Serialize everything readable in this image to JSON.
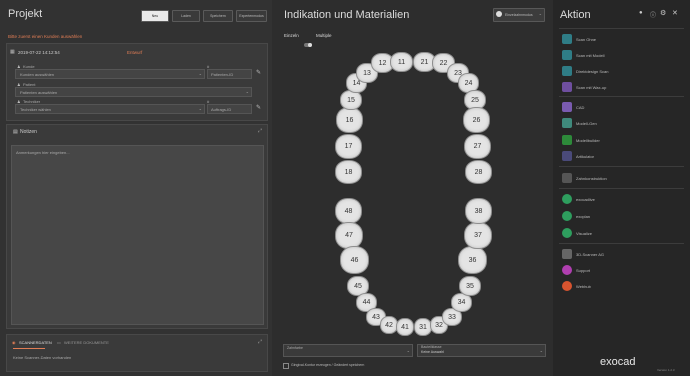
{
  "project": {
    "title": "Projekt",
    "toolbar": [
      "Neu",
      "Laden",
      "Speichern",
      "Expertenmodus"
    ],
    "warning": "Bitte zuerst einen Kunden auswählen",
    "date": "2019-07-22 14:12:54",
    "status_label": "Entwurf",
    "client": {
      "label": "Kunde",
      "value": "Kunden auswählen"
    },
    "patient": {
      "label": "Patient",
      "value": "Patienten auswählen"
    },
    "technician": {
      "label": "Techniker",
      "value": "Techniker wählen"
    },
    "id_placeholders": [
      "Patienten-ID",
      "Auftrags-ID"
    ],
    "notes_title": "Notizen",
    "notes_placeholder": "Anmerkungen hier eingeben...",
    "bottom_tabs": [
      "SCANNERDATEN",
      "WEITERE DOKUMENTE"
    ],
    "bottom_text": "Keine Scanner-Daten vorhanden"
  },
  "indikation": {
    "title": "Indikation und Materialien",
    "mode_label": "Einzelzahnmodus",
    "toggle_left": "Einzeln",
    "toggle_right": "Multiple",
    "teeth_upper": [
      "18",
      "17",
      "16",
      "15",
      "14",
      "13",
      "12",
      "11",
      "21",
      "22",
      "23",
      "24",
      "25",
      "26",
      "27",
      "28"
    ],
    "teeth_lower": [
      "48",
      "47",
      "46",
      "45",
      "44",
      "43",
      "42",
      "41",
      "31",
      "32",
      "33",
      "34",
      "35",
      "36",
      "37",
      "38"
    ],
    "select_left": "Zahnfarbe",
    "select_right_label": "Bauteilklasse",
    "select_right_value": "Keine Auswahl",
    "checkbox_label": "Gingival-Kontur erzeugen / Geändert speichern"
  },
  "aktion": {
    "title": "Aktion",
    "items_group1": [
      {
        "label": "Scan Ohne",
        "color": "#2f7d86"
      },
      {
        "label": "Scan mit Modell",
        "color": "#2f7d86"
      },
      {
        "label": "Direktdesign Scan",
        "color": "#2f7d86"
      },
      {
        "label": "Scan mit Wax-up",
        "color": "#6f4fa0"
      }
    ],
    "items_group2": [
      {
        "label": "CAD",
        "color": "#7a5bb0"
      },
      {
        "label": "Modell-Gen",
        "color": "#3f8a7c"
      },
      {
        "label": "Modellbuilder",
        "color": "#2d8a3a"
      },
      {
        "label": "Artikulator",
        "color": "#4a4a7a"
      }
    ],
    "items_group3": [
      {
        "label": "Zahnkonstruktion",
        "color": "#555555"
      }
    ],
    "items_group4": [
      {
        "label": "exocadlive",
        "color": "#2e9e5e"
      },
      {
        "label": "exoplan",
        "color": "#2e9e5e"
      },
      {
        "label": "Visualize",
        "color": "#2e9e5e"
      }
    ],
    "items_group5": [
      {
        "label": "3D-Scanner AG",
        "color": "#666666"
      },
      {
        "label": "Support",
        "color": "#b03fb0"
      },
      {
        "label": "Webhub",
        "color": "#d8542f"
      }
    ],
    "brand": "exocad",
    "version": "Version 1.2.3"
  }
}
